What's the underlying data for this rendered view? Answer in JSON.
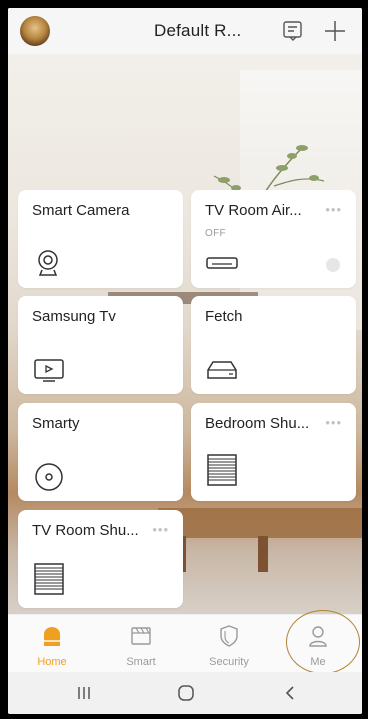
{
  "header": {
    "home_name": "Default R...",
    "icons": [
      "avatar",
      "messages-icon",
      "add-icon"
    ]
  },
  "devices": [
    {
      "name": "Smart Camera",
      "icon": "camera-icon",
      "status": "",
      "more": ""
    },
    {
      "name": "TV Room Air...",
      "icon": "ac-unit-icon",
      "status": "OFF",
      "more": "•••"
    },
    {
      "name": "Samsung Tv",
      "icon": "tv-icon",
      "status": "",
      "more": ""
    },
    {
      "name": "Fetch",
      "icon": "settop-box-icon",
      "status": "",
      "more": ""
    },
    {
      "name": "Smarty",
      "icon": "speaker-icon",
      "status": "",
      "more": ""
    },
    {
      "name": "Bedroom Shu...",
      "icon": "shutter-icon",
      "status": "",
      "more": "•••"
    },
    {
      "name": "TV Room Shu...",
      "icon": "shutter-icon",
      "status": "",
      "more": "•••"
    }
  ],
  "tabs": [
    {
      "label": "Home",
      "icon": "home-icon",
      "active": true
    },
    {
      "label": "Smart",
      "icon": "smart-icon",
      "active": false
    },
    {
      "label": "Security",
      "icon": "shield-icon",
      "active": false
    },
    {
      "label": "Me",
      "icon": "person-icon",
      "active": false
    }
  ],
  "system_nav": [
    "recents-button",
    "home-button",
    "back-button"
  ],
  "colors": {
    "accent": "#f0a020",
    "annotation_circle": "#b08433",
    "card": "#ffffff",
    "inactive": "#9b9b9b"
  }
}
